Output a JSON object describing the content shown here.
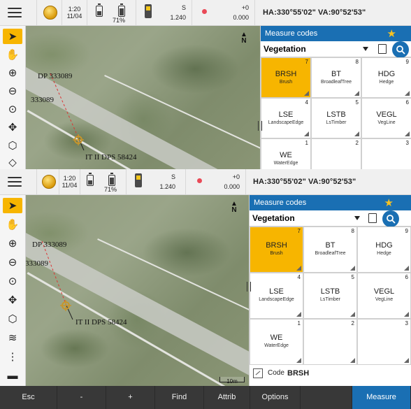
{
  "status": {
    "time": "1:20",
    "date": "11/04",
    "battery": "71%",
    "s_label": "S",
    "s_value": "1.240",
    "offset_label": "+0",
    "offset_value": "0.000",
    "angles": "HA:330°55'02\"  VA:90°52'53\""
  },
  "panel": {
    "title": "Measure codes",
    "group": "Vegetation",
    "codes": [
      {
        "num": "7",
        "code": "BRSH",
        "desc": "Brush",
        "selected": true
      },
      {
        "num": "8",
        "code": "BT",
        "desc": "BroadleafTree"
      },
      {
        "num": "9",
        "code": "HDG",
        "desc": "Hedge"
      },
      {
        "num": "4",
        "code": "LSE",
        "desc": "LandscapeEdge"
      },
      {
        "num": "5",
        "code": "LSTB",
        "desc": "LsTimber"
      },
      {
        "num": "6",
        "code": "VEGL",
        "desc": "VegLine"
      },
      {
        "num": "1",
        "code": "WE",
        "desc": "WaterEdge"
      },
      {
        "num": "2",
        "code": "",
        "desc": ""
      },
      {
        "num": "3",
        "code": "",
        "desc": ""
      }
    ],
    "code_label": "Code",
    "code_value": "BRSH"
  },
  "map": {
    "label_dp": "DP 333089",
    "label_dp2": "333089",
    "label_station": "IT II DPS 58424",
    "north": "N",
    "scale": "10m"
  },
  "softkeys": [
    "Esc",
    "-",
    "+",
    "Find",
    "Attrib",
    "Options",
    "",
    "Measure"
  ],
  "colors": {
    "accent": "#1a6fb3",
    "selected": "#f7b500",
    "bottombar": "#383838"
  }
}
